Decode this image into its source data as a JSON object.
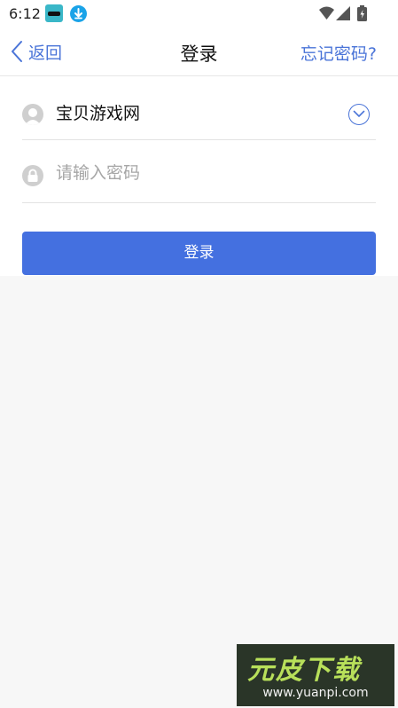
{
  "status_bar": {
    "time": "6:12"
  },
  "nav": {
    "back_label": "返回",
    "title": "登录",
    "forgot_label": "忘记密码?"
  },
  "form": {
    "username_value": "宝贝游戏网",
    "password_placeholder": "请输入密码",
    "login_label": "登录"
  },
  "watermark": {
    "title": "元皮下载",
    "url": "www.yuanpi.com"
  },
  "colors": {
    "accent": "#4a74d8",
    "login_button": "#4470e0",
    "page_background": "#f7f7f7"
  }
}
